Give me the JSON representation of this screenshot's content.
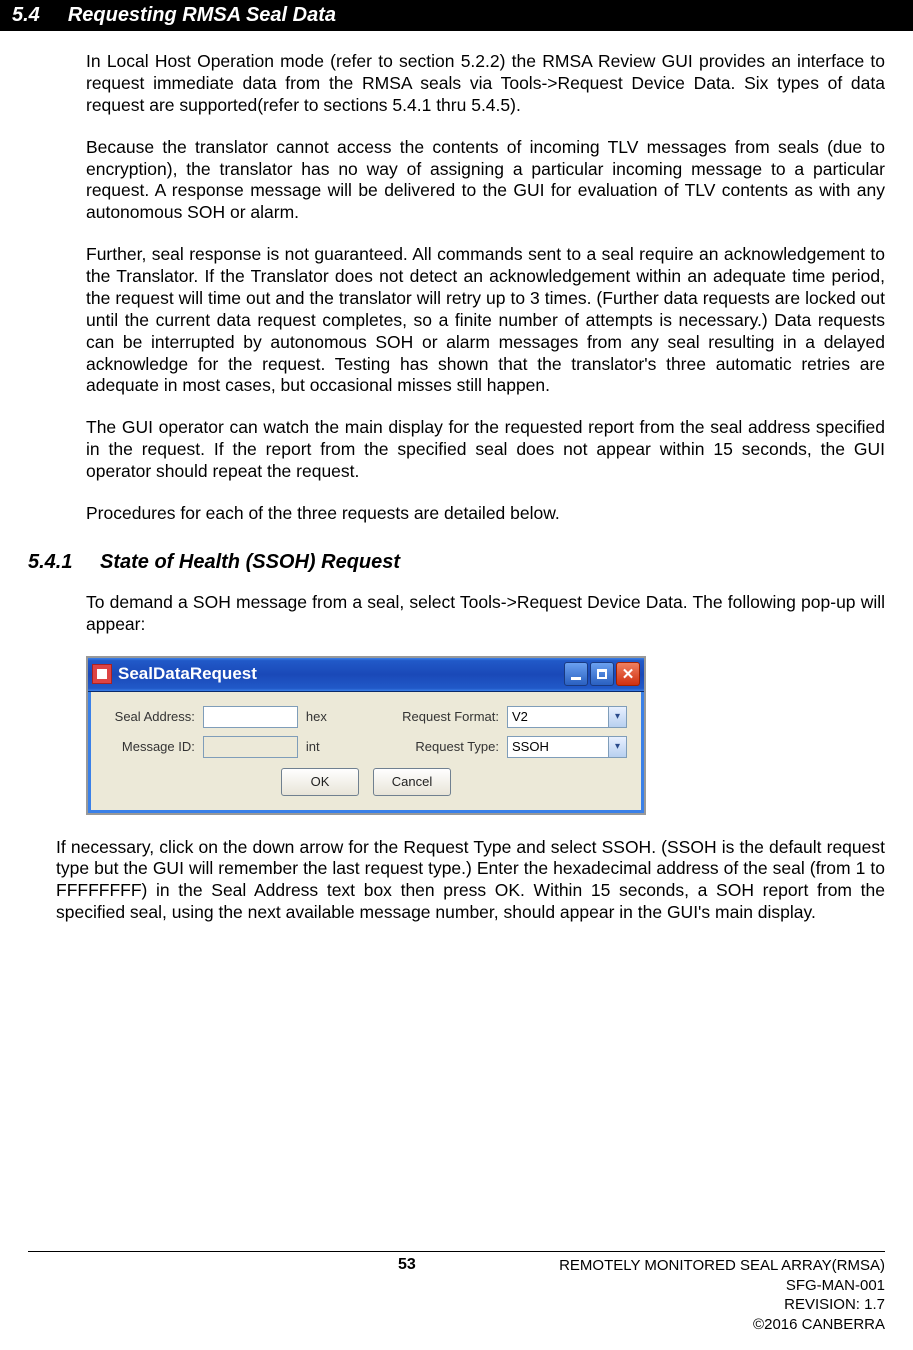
{
  "section": {
    "number": "5.4",
    "title": "Requesting RMSA Seal Data"
  },
  "paragraphs": {
    "p1": "In Local Host Operation mode (refer to section 5.2.2) the RMSA Review GUI provides an interface to request immediate data from the RMSA seals via Tools->Request Device Data. Six types of data request are supported(refer to sections 5.4.1 thru 5.4.5).",
    "p2": "Because the translator cannot access the contents of incoming TLV messages from seals (due to encryption), the translator has no way of assigning a particular incoming message to a particular request.  A response message will be delivered to the GUI for evaluation of TLV contents as with any autonomous SOH or alarm.",
    "p3": "Further, seal response is not guaranteed.  All commands sent to a seal require an acknowledgement to the Translator.  If the Translator does not detect an acknowledgement within an adequate time period, the request will time out and the translator will retry up to 3 times.  (Further data requests are locked out until the current data request completes, so a finite number of attempts is necessary.)  Data requests can be interrupted by autonomous SOH or alarm messages from any seal resulting in a delayed acknowledge for the request. Testing has shown that the translator's three automatic retries are adequate in most cases, but occasional misses still happen.",
    "p4": "The GUI operator can watch the main display for the requested report from the seal address specified in the request.  If the report from the specified seal does not appear within 15 seconds, the GUI operator should repeat the request.",
    "p5": "Procedures for each of the three requests are detailed below."
  },
  "subsection": {
    "number": "5.4.1",
    "title": "State of Health (SSOH) Request"
  },
  "subparagraphs": {
    "sp1": "To demand a SOH message from a seal, select Tools->Request Device Data.  The following pop-up will appear:",
    "sp2": "If necessary, click on the down arrow for the Request Type and select SSOH.  (SSOH is the default request type but the GUI will remember the last request type.)  Enter the hexadecimal address of the seal (from 1 to FFFFFFFF) in the Seal Address text box then press OK.  Within 15 seconds, a SOH report from the specified seal, using the next available message number, should appear in the GUI's main display."
  },
  "dialog": {
    "title": "SealDataRequest",
    "labels": {
      "seal_address": "Seal Address:",
      "message_id": "Message ID:",
      "request_format": "Request Format:",
      "request_type": "Request Type:",
      "hex": "hex",
      "int": "int"
    },
    "values": {
      "seal_address": "",
      "message_id": "",
      "request_format": "V2",
      "request_type": "SSOH"
    },
    "buttons": {
      "ok": "OK",
      "cancel": "Cancel"
    }
  },
  "footer": {
    "page": "53",
    "line1": "REMOTELY MONITORED SEAL ARRAY(RMSA)",
    "line2": "SFG-MAN-001",
    "line3": "REVISION: 1.7",
    "line4": "©2016 CANBERRA"
  }
}
